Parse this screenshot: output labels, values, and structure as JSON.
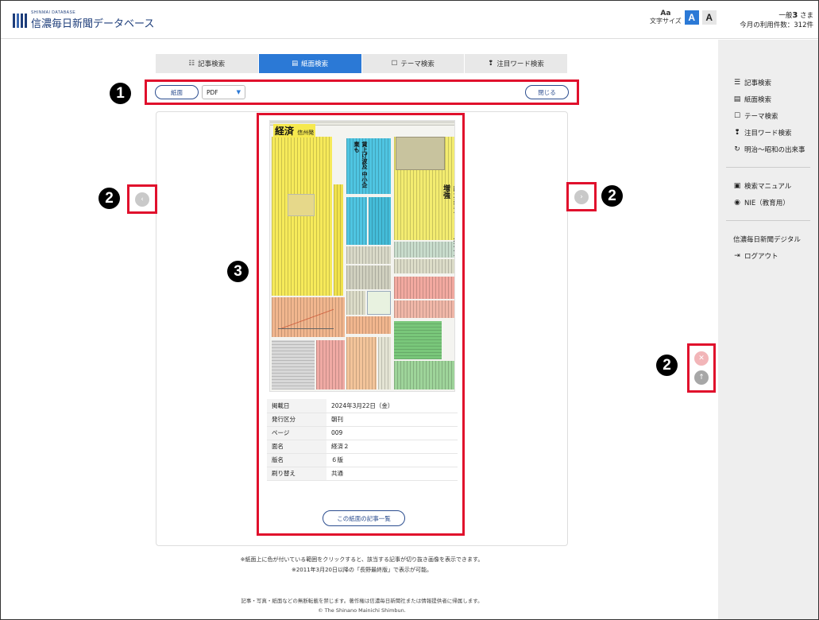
{
  "header": {
    "logo_small": "SHINMAI DATABASE",
    "logo_main": "信濃毎日新聞データベース",
    "font_size_label": "文字サイズ",
    "font_size_icon": "Aa",
    "font_large": "A",
    "font_small": "A",
    "user_name_prefix": "一般",
    "user_name_number": "3",
    "user_name_suffix": " さま",
    "usage": "今月の利用件数：312件"
  },
  "tabs": [
    {
      "label": "記事検索",
      "icon": "☷",
      "active": false
    },
    {
      "label": "紙面検索",
      "icon": "▤",
      "active": true
    },
    {
      "label": "テーマ検索",
      "icon": "☐",
      "active": false
    },
    {
      "label": "注目ワード検索",
      "icon": "❢",
      "active": false
    }
  ],
  "toolbar": {
    "paper_button": "紙面",
    "format_select": "PDF",
    "close_button": "閉じる"
  },
  "badges": {
    "one": "1",
    "two": "2",
    "three": "3"
  },
  "nav": {
    "prev": "‹",
    "next": "›",
    "close": "✕",
    "top": "↑"
  },
  "newspaper": {
    "masthead": "経済",
    "masthead_sub": "信州発",
    "headline_main": "純水装置 シェア拡大へ増強",
    "headline_side": "賃上げ波及 中小企業も"
  },
  "info": [
    {
      "key": "掲載日",
      "value": "2024年3月22日（金）"
    },
    {
      "key": "発行区分",
      "value": "朝刊"
    },
    {
      "key": "ページ",
      "value": "009"
    },
    {
      "key": "面名",
      "value": "経済２"
    },
    {
      "key": "版名",
      "value": "６版"
    },
    {
      "key": "刷り替え",
      "value": "共通"
    }
  ],
  "article_list_button": "この紙面の記事一覧",
  "notes": [
    "※紙面上に色が付いている範囲をクリックすると、該当する記事が切り抜き画像を表示できます。",
    "※2011年3月20日以降の「長野最終版」で表示が可能。"
  ],
  "footer": [
    "記事・写真・紙面などの無断転載を禁じます。著作権は信濃毎日新聞社または情報提供者に帰属します。",
    "© The Shinano Mainichi Shimbun."
  ],
  "sidebar": {
    "group1": [
      {
        "label": "記事検索",
        "icon": "☰"
      },
      {
        "label": "紙面検索",
        "icon": "▤"
      },
      {
        "label": "テーマ検索",
        "icon": "☐"
      },
      {
        "label": "注目ワード検索",
        "icon": "❢"
      },
      {
        "label": "明治〜昭和の出来事",
        "icon": "↻"
      }
    ],
    "group2": [
      {
        "label": "検索マニュアル",
        "icon": "▣"
      },
      {
        "label": "NIE（教育用）",
        "icon": "◉"
      }
    ],
    "group3": [
      {
        "label": "信濃毎日新聞デジタル",
        "icon": ""
      },
      {
        "label": "ログアウト",
        "icon": "⇥"
      }
    ]
  }
}
